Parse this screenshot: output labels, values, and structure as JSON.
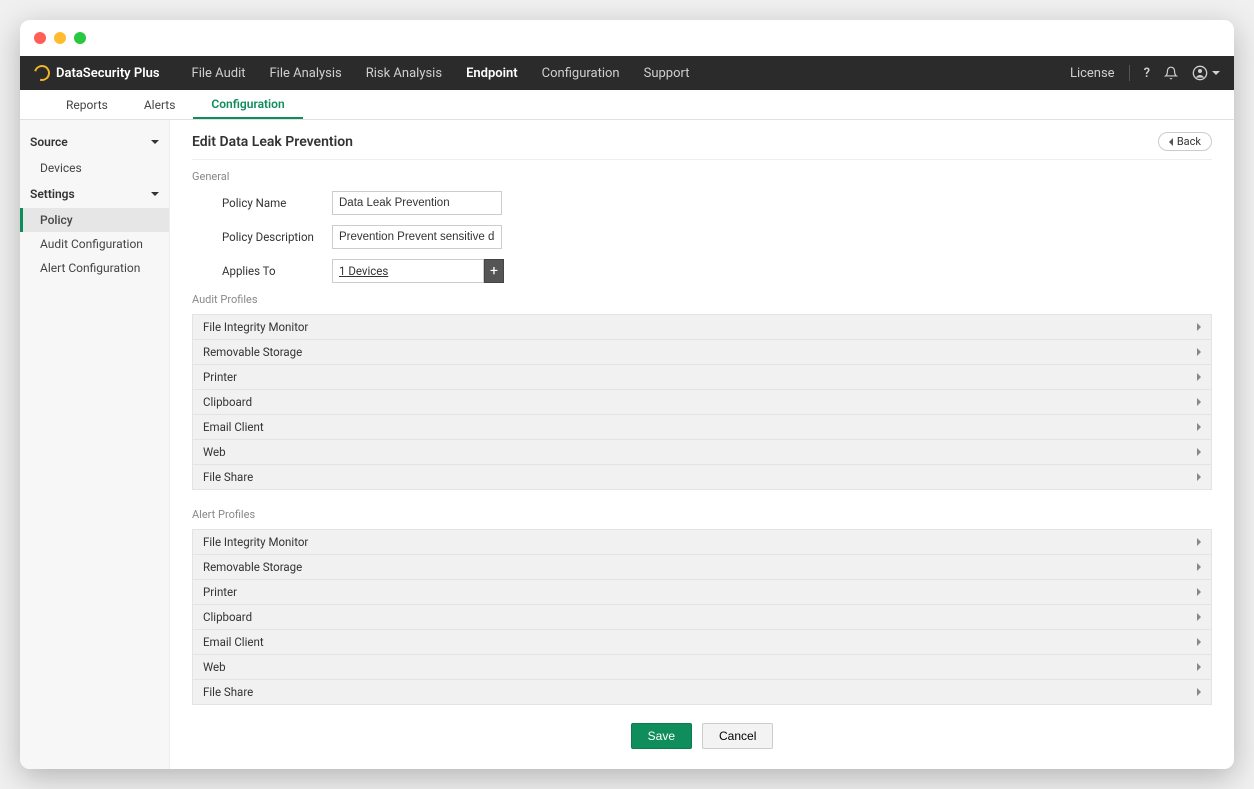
{
  "brand": "DataSecurity Plus",
  "topnav": {
    "items": [
      "File Audit",
      "File Analysis",
      "Risk Analysis",
      "Endpoint",
      "Configuration",
      "Support"
    ],
    "active": "Endpoint",
    "license": "License"
  },
  "subnav": {
    "items": [
      "Reports",
      "Alerts",
      "Configuration"
    ],
    "active": "Configuration"
  },
  "sidebar": {
    "source_label": "Source",
    "source_items": [
      "Devices"
    ],
    "settings_label": "Settings",
    "settings_items": [
      "Policy",
      "Audit Configuration",
      "Alert Configuration"
    ],
    "active": "Policy"
  },
  "page": {
    "title": "Edit Data Leak Prevention",
    "back": "Back",
    "general_label": "General",
    "policy_name_label": "Policy Name",
    "policy_name_value": "Data Leak Prevention",
    "policy_desc_label": "Policy Description",
    "policy_desc_value": "Prevention Prevent sensitive data from get",
    "applies_label": "Applies To",
    "applies_value": "1 Devices",
    "audit_label": "Audit Profiles",
    "audit_profiles": [
      "File Integrity Monitor",
      "Removable Storage",
      "Printer",
      "Clipboard",
      "Email Client",
      "Web",
      "File Share"
    ],
    "alert_label": "Alert Profiles",
    "alert_profiles": [
      "File Integrity Monitor",
      "Removable Storage",
      "Printer",
      "Clipboard",
      "Email Client",
      "Web",
      "File Share"
    ],
    "save": "Save",
    "cancel": "Cancel"
  }
}
